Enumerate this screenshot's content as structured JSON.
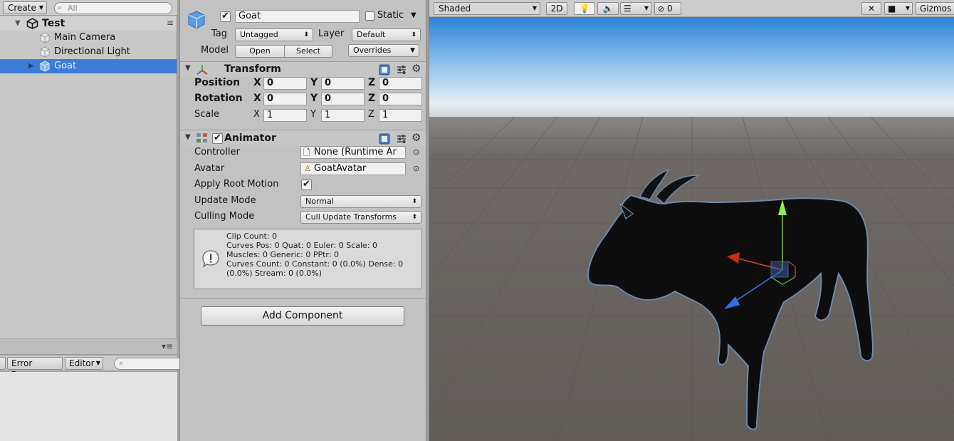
{
  "hierarchy": {
    "create_label": "Create",
    "search_placeholder": "All",
    "scene_name": "Test",
    "items": [
      {
        "label": "Main Camera"
      },
      {
        "label": "Directional Light"
      },
      {
        "label": "Goat"
      }
    ]
  },
  "console": {
    "toolbar": {
      "error_pause": "Error Pause",
      "editor": "Editor"
    }
  },
  "inspector": {
    "object_name": "Goat",
    "static_label": "Static",
    "tag_label": "Tag",
    "tag_value": "Untagged",
    "layer_label": "Layer",
    "layer_value": "Default",
    "model_label": "Model",
    "open_label": "Open",
    "select_label": "Select",
    "overrides_label": "Overrides",
    "transform": {
      "title": "Transform",
      "position_label": "Position",
      "rotation_label": "Rotation",
      "scale_label": "Scale",
      "axis_x": "X",
      "axis_y": "Y",
      "axis_z": "Z",
      "position": {
        "x": "0",
        "y": "0",
        "z": "0"
      },
      "rotation": {
        "x": "0",
        "y": "0",
        "z": "0"
      },
      "scale": {
        "x": "1",
        "y": "1",
        "z": "1"
      }
    },
    "animator": {
      "title": "Animator",
      "controller_label": "Controller",
      "controller_value": "None (Runtime Ar",
      "avatar_label": "Avatar",
      "avatar_value": "GoatAvatar",
      "apply_root_motion_label": "Apply Root Motion",
      "update_mode_label": "Update Mode",
      "update_mode_value": "Normal",
      "culling_mode_label": "Culling Mode",
      "culling_mode_value": "Cull Update Transforms",
      "info_lines": [
        "Clip Count: 0",
        "Curves Pos: 0 Quat: 0 Euler: 0 Scale: 0",
        "Muscles: 0 Generic: 0 PPtr: 0",
        "Curves Count: 0 Constant: 0 (0.0%) Dense: 0",
        "(0.0%) Stream: 0 (0.0%)"
      ]
    },
    "add_component_label": "Add Component"
  },
  "scene": {
    "shading_mode": "Shaded",
    "mode_2d": "2D",
    "hidden_count": "0",
    "gizmos_label": "Gizmos"
  },
  "icons": {
    "search": "search-icon",
    "unity_scene": "unity-logo-icon",
    "gameobject": "cube-icon",
    "prefab": "prefab-cube-icon",
    "transform": "transform-axes-icon",
    "animator": "animator-icon",
    "help": "help-book-icon",
    "presets": "presets-sliders-icon",
    "settings": "gear-icon",
    "info": "info-bubble-icon"
  },
  "colors": {
    "selection": "#3d7bd8",
    "panel": "#c2c2c2",
    "sky_top": "#2c82d8",
    "ground": "#6b6662"
  }
}
